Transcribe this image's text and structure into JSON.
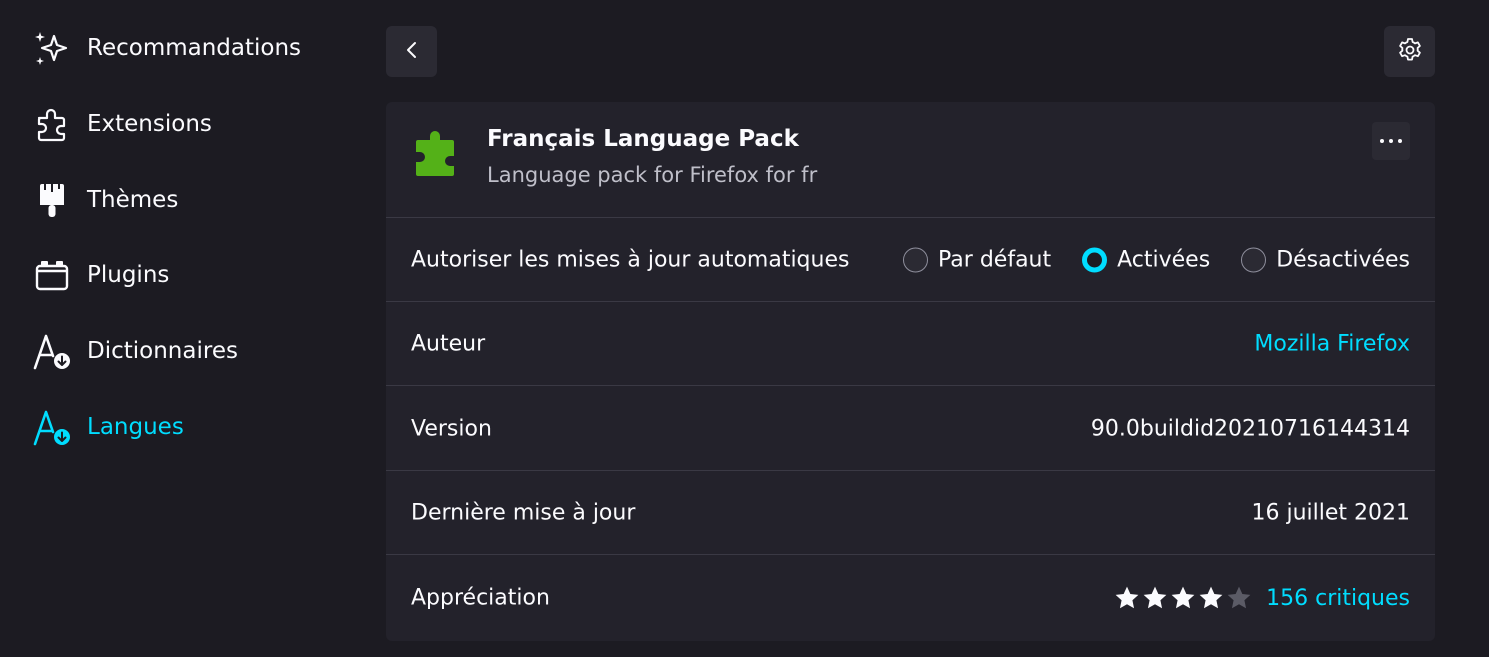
{
  "sidebar": {
    "items": [
      {
        "label": "Recommandations",
        "icon": "sparkle-icon",
        "selected": false
      },
      {
        "label": "Extensions",
        "icon": "puzzle-icon",
        "selected": false
      },
      {
        "label": "Thèmes",
        "icon": "paintbrush-icon",
        "selected": false
      },
      {
        "label": "Plugins",
        "icon": "plugin-icon",
        "selected": false
      },
      {
        "label": "Dictionnaires",
        "icon": "dictionary-icon",
        "selected": false
      },
      {
        "label": "Langues",
        "icon": "language-icon",
        "selected": true
      }
    ]
  },
  "toolbar": {
    "back_icon": "chevron-left-icon",
    "settings_icon": "gear-icon"
  },
  "addon": {
    "name": "Français Language Pack",
    "description": "Language pack for Firefox for fr",
    "icon": "puzzle-piece-icon",
    "icon_color": "#54b118",
    "more_icon": "more-options-icon"
  },
  "details": {
    "updates": {
      "label": "Autoriser les mises à jour automatiques",
      "options": [
        {
          "label": "Par défaut",
          "checked": false
        },
        {
          "label": "Activées",
          "checked": true
        },
        {
          "label": "Désactivées",
          "checked": false
        }
      ]
    },
    "author": {
      "label": "Auteur",
      "value": "Mozilla Firefox"
    },
    "version": {
      "label": "Version",
      "value": "90.0buildid20210716144314"
    },
    "last_updated": {
      "label": "Dernière mise à jour",
      "value": "16 juillet 2021"
    },
    "rating": {
      "label": "Appréciation",
      "stars": 4,
      "max_stars": 5,
      "reviews": "156 critiques"
    }
  },
  "colors": {
    "background": "#1c1b22",
    "card": "#23222b",
    "accent": "#00ddff",
    "text": "#fbfbfe"
  }
}
